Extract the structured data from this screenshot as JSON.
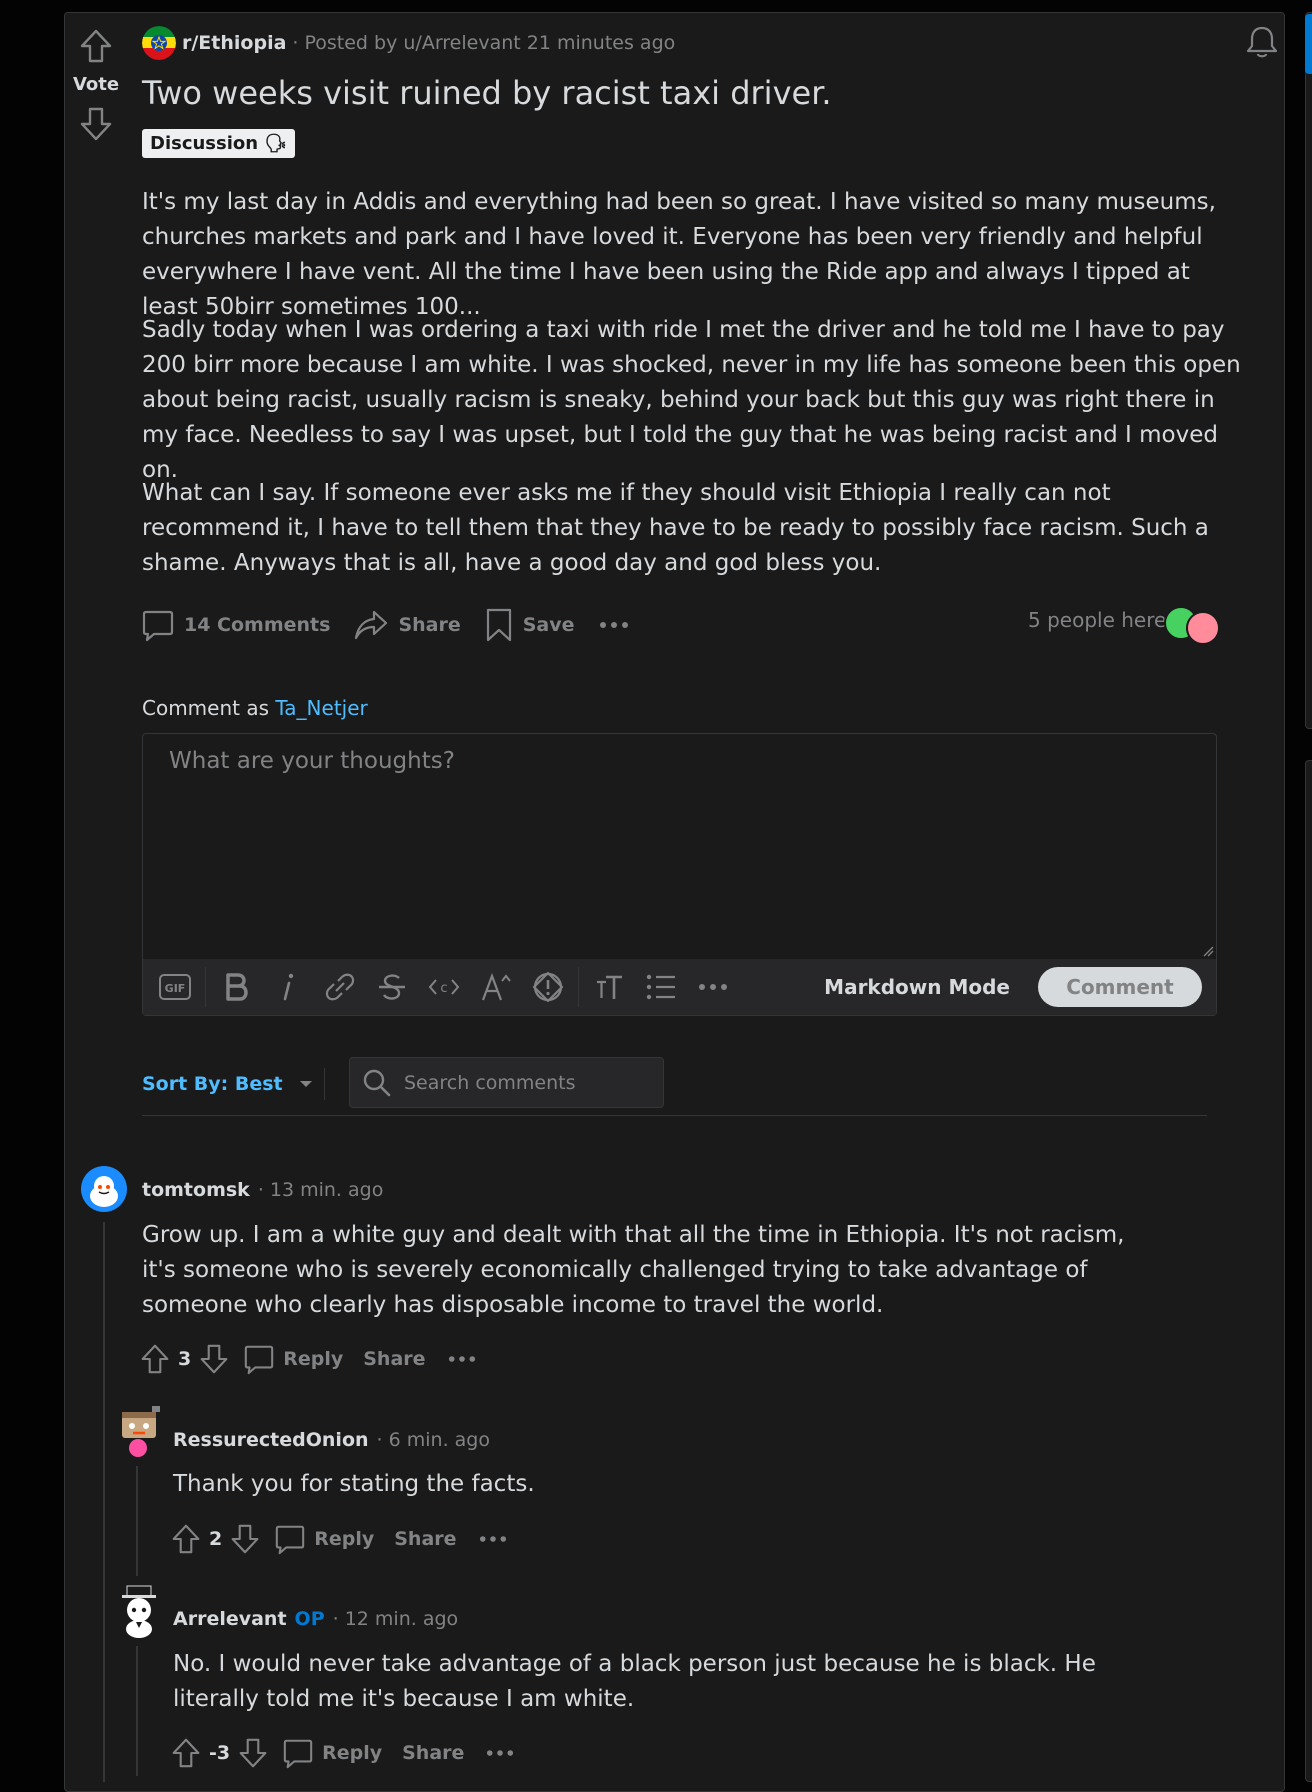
{
  "post": {
    "vote_label": "Vote",
    "subreddit": "r/Ethiopia",
    "posted_by": "· Posted by u/Arrelevant 21 minutes ago",
    "title": "Two weeks visit ruined by racist taxi driver.",
    "flair": "Discussion 🗣",
    "body": [
      "It's my last day in Addis and everything had been so great. I have visited so many museums, churches markets and park and I have loved it. Everyone has been very friendly and helpful everywhere I have vent. All the time I have been using the Ride app and always I tipped at least 50birr sometimes 100...",
      "Sadly today when I was ordering a taxi with ride I met the driver and he told me I have to pay 200 birr more because I am white. I was shocked, never in my life has someone been this open about being racist, usually racism is sneaky, behind your back but this guy was right there in my face. Needless to say I was upset, but I told the guy that he was being racist and I moved on.",
      "What can I say. If someone ever asks me if they should visit Ethiopia I really can not recommend it, I have to tell them that they have to be ready to possibly face racism. Such a shame. Anyways that is all, have a good day and god bless you."
    ],
    "actions": {
      "comments": "14 Comments",
      "share": "Share",
      "save": "Save"
    },
    "people_here": "5 people here"
  },
  "composer": {
    "comment_as_prefix": "Comment as",
    "username": "Ta_Netjer",
    "placeholder": "What are your thoughts?",
    "markdown_mode": "Markdown Mode",
    "submit": "Comment",
    "toolbar_icons": [
      "gif-icon",
      "bold-icon",
      "italic-icon",
      "link-icon",
      "strikethrough-icon",
      "inline-code-icon",
      "superscript-icon",
      "spoiler-icon",
      "heading-icon",
      "bulleted-list-icon",
      "more-icon"
    ]
  },
  "sort": {
    "label": "Sort By: Best",
    "search_placeholder": "Search comments"
  },
  "comments": [
    {
      "author": "tomtomsk",
      "time": "· 13 min. ago",
      "body": "Grow up. I am a white guy and dealt with that all the time in Ethiopia. It's not racism, it's someone who is severely economically challenged trying to take advantage of someone who clearly has disposable income to travel the world.",
      "score": "3",
      "reply": "Reply",
      "share": "Share"
    },
    {
      "author": "RessurectedOnion",
      "time": "· 6 min. ago",
      "body": "Thank you for stating the facts.",
      "score": "2",
      "reply": "Reply",
      "share": "Share"
    },
    {
      "author": "Arrelevant",
      "op": "OP",
      "time": "· 12 min. ago",
      "body": "No. I would never take advantage of a black person just because he is black. He literally told me it's because I am white.",
      "score": "-3",
      "reply": "Reply",
      "share": "Share"
    }
  ],
  "colors": {
    "background": "#030303",
    "card": "#1a1a1b",
    "border": "#343536",
    "text": "#d7dadc",
    "muted": "#818384",
    "link": "#4fbcff",
    "op": "#0079d3"
  }
}
